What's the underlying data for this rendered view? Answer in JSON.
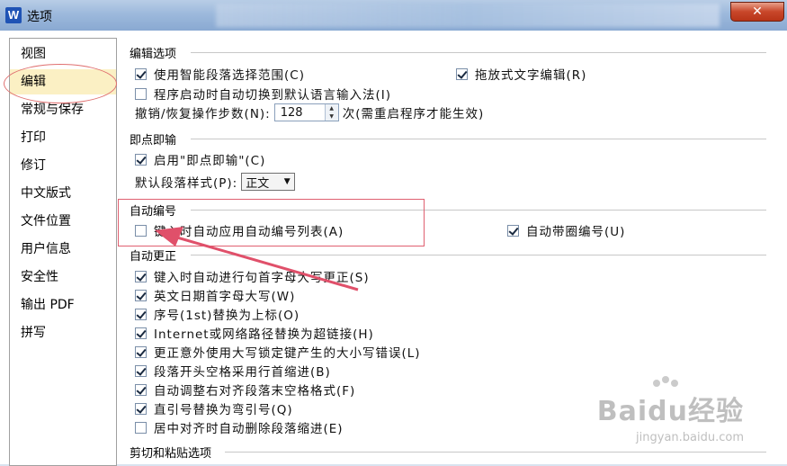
{
  "window": {
    "title": "选项",
    "app_icon_letter": "W",
    "close_label": "✕"
  },
  "sidebar": {
    "items": [
      {
        "label": "视图"
      },
      {
        "label": "编辑",
        "selected": true
      },
      {
        "label": "常规与保存"
      },
      {
        "label": "打印"
      },
      {
        "label": "修订"
      },
      {
        "label": "中文版式"
      },
      {
        "label": "文件位置"
      },
      {
        "label": "用户信息"
      },
      {
        "label": "安全性"
      },
      {
        "label": "输出 PDF"
      },
      {
        "label": "拼写"
      }
    ]
  },
  "sections": {
    "edit": {
      "title": "编辑选项",
      "smart_select": {
        "label": "使用智能段落选择范围(C)",
        "checked": true
      },
      "drag_edit": {
        "label": "拖放式文字编辑(R)",
        "checked": true
      },
      "auto_ime": {
        "label": "程序启动时自动切换到默认语言输入法(I)",
        "checked": false
      },
      "undo_prefix": "撤销/恢复操作步数(N):",
      "undo_value": "128",
      "undo_suffix": "次(需重启程序才能生效)"
    },
    "click_type": {
      "title": "即点即输",
      "enable": {
        "label": "启用\"即点即输\"(C)",
        "checked": true
      },
      "default_style_label": "默认段落样式(P):",
      "default_style_value": "正文"
    },
    "auto_number": {
      "title": "自动编号",
      "apply_list": {
        "label": "键入时自动应用自动编号列表(A)",
        "checked": false
      },
      "circle_number": {
        "label": "自动带圈编号(U)",
        "checked": true
      }
    },
    "auto_correct": {
      "title": "自动更正",
      "items": [
        {
          "label": "键入时自动进行句首字母大写更正(S)",
          "checked": true
        },
        {
          "label": "英文日期首字母大写(W)",
          "checked": true
        },
        {
          "label": "序号(1st)替换为上标(O)",
          "checked": true
        },
        {
          "label": "Internet或网络路径替换为超链接(H)",
          "checked": true
        },
        {
          "label": "更正意外使用大写锁定键产生的大小写错误(L)",
          "checked": true
        },
        {
          "label": "段落开头空格采用行首缩进(B)",
          "checked": true
        },
        {
          "label": "自动调整右对齐段落末空格格式(F)",
          "checked": true
        },
        {
          "label": "直引号替换为弯引号(Q)",
          "checked": true
        },
        {
          "label": "居中对齐时自动删除段落缩进(E)",
          "checked": false
        }
      ]
    },
    "cut_paste": {
      "title": "剪切和粘贴选项"
    }
  },
  "watermark": {
    "brand": "Baidu经验",
    "url": "jingyan.baidu.com"
  },
  "colors": {
    "annotation_red": "#e06070",
    "selected_bg": "#fbf0c4"
  }
}
